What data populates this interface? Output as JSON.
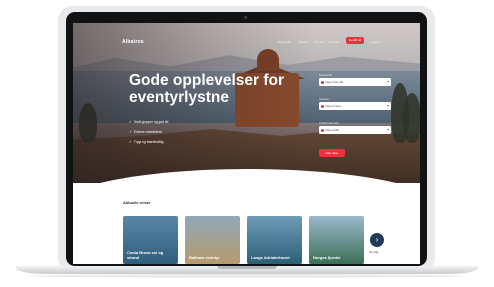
{
  "site": {
    "logo": "Albatros"
  },
  "nav": {
    "links": [
      "Reisemål",
      "Reiser",
      "Om oss",
      "Kontakt"
    ],
    "cta": "Bestill nå",
    "extra": "Logg inn"
  },
  "hero": {
    "title": "Gode opplevelser for eventyrlystne",
    "bullets": [
      "Små grupper og god tid",
      "Erfarne reiseledere",
      "Trygt og bærekraftig"
    ]
  },
  "booking": {
    "fields": [
      {
        "label": "Reisemål",
        "value": "Velg reisemål"
      },
      {
        "label": "Avreise",
        "value": "Velg avreise"
      },
      {
        "label": "Antall reisende",
        "value": "Velg antall"
      }
    ],
    "search_label": "Søk reise"
  },
  "section": {
    "title": "Aktuelle reiser",
    "see_all": "Se alle"
  },
  "cards": [
    {
      "label": "Costa Brava sol og strand",
      "color_top": "#5b86a6",
      "color_bottom": "#2f5f7c"
    },
    {
      "label": "Balkans eventyr",
      "color_top": "#8fa8b7",
      "color_bottom": "#b79a6d"
    },
    {
      "label": "Langs Adriaterhavet",
      "color_top": "#6e9cb8",
      "color_bottom": "#2c5e77"
    },
    {
      "label": "Norges fjorder",
      "color_top": "#9bb9cc",
      "color_bottom": "#3c6f55"
    }
  ],
  "colors": {
    "accent": "#e8343c",
    "navy": "#1f3b57"
  }
}
